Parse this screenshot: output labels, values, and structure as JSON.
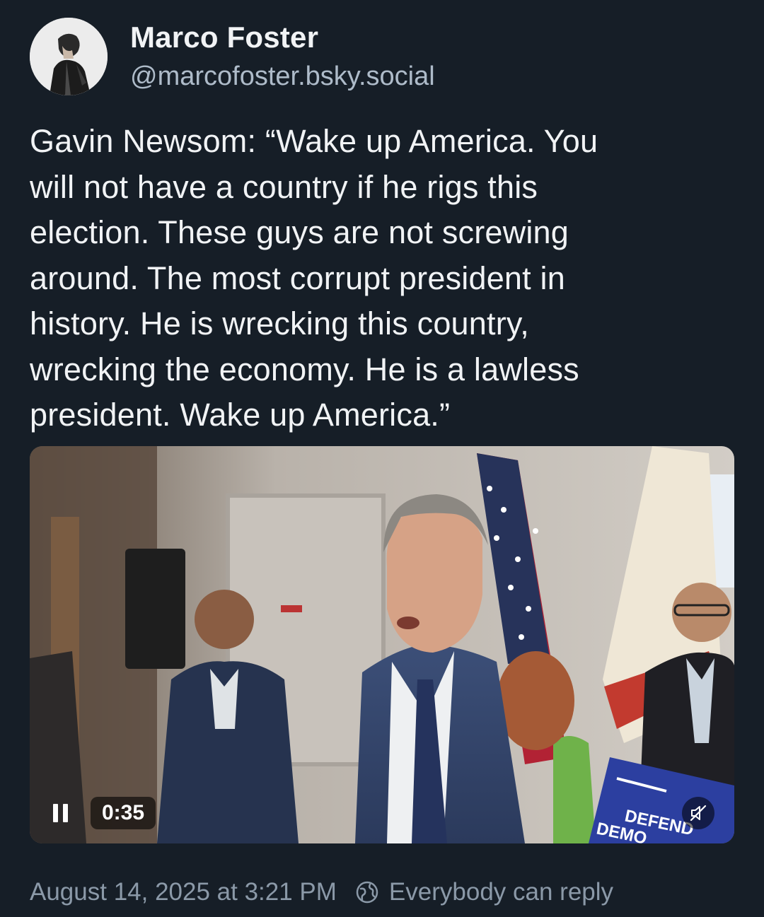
{
  "author": {
    "display_name": "Marco Foster",
    "handle": "@marcofoster.bsky.social"
  },
  "post": {
    "text": "Gavin Newsom: “Wake up America. You\nwill not have a country if he rigs this\nelection. These guys are not screwing\naround. The most corrupt president in\nhistory. He is wrecking this country,\nwrecking the economy. He is a lawless\npresident. Wake up America.”"
  },
  "video": {
    "time": "0:35",
    "sign_text_1": "DEFEND",
    "sign_text_2": "DEMO"
  },
  "footer": {
    "timestamp": "August 14, 2025 at 3:21 PM",
    "reply_setting": "Everybody can reply"
  },
  "colors": {
    "background": "#161e27",
    "text_primary": "#f1f3f5",
    "text_secondary": "#aebbc9",
    "text_muted": "#8b99a8"
  },
  "icons": {
    "pause": "pause-icon",
    "mute": "muted-speaker-icon",
    "reply": "globe-icon"
  }
}
